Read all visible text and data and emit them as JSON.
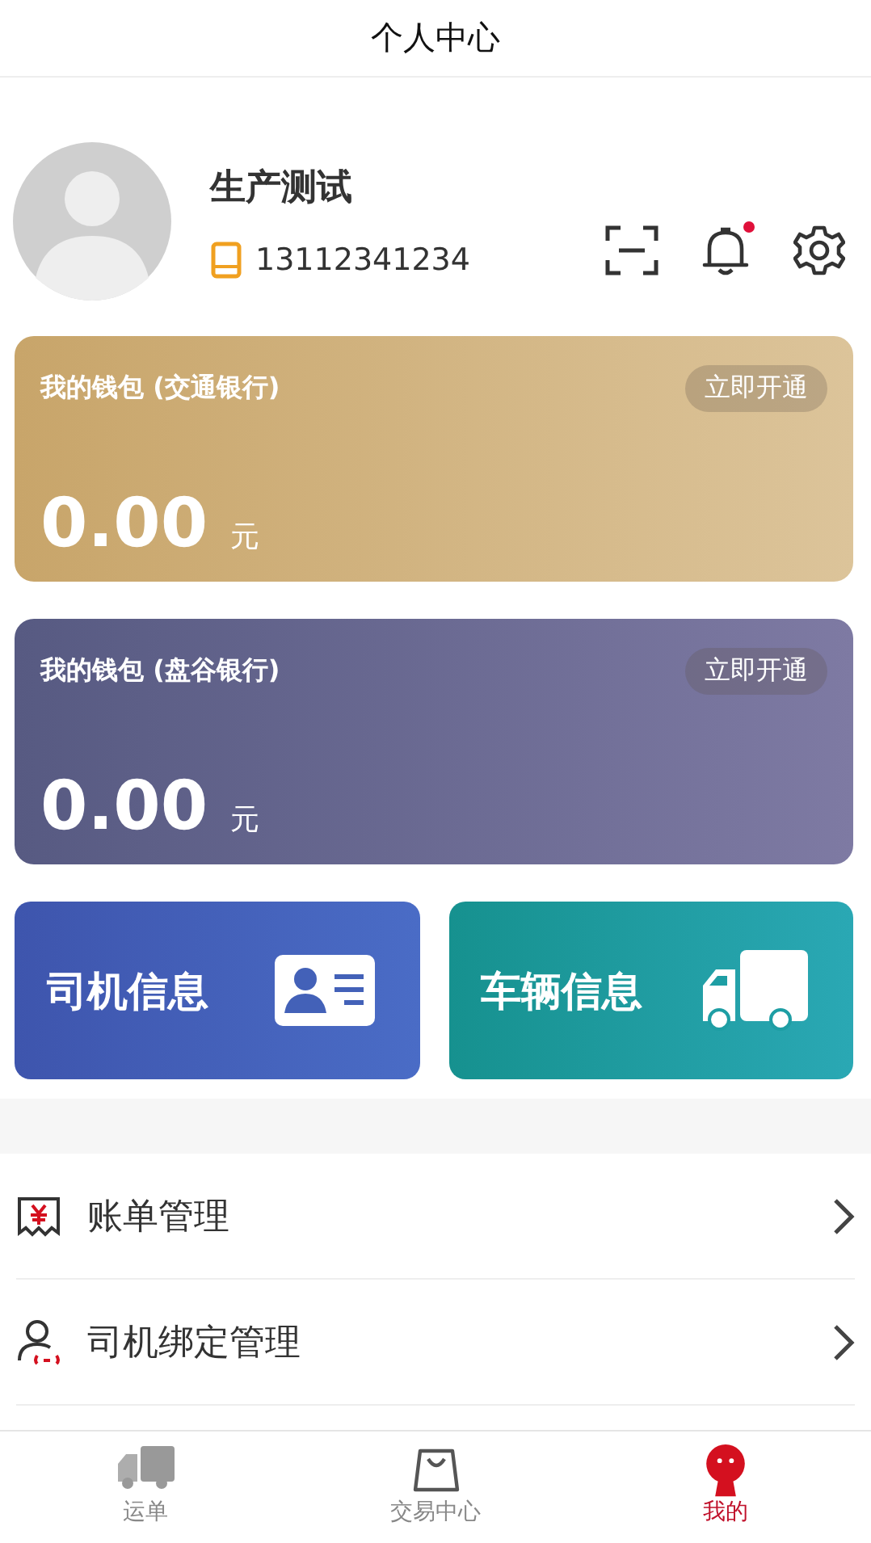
{
  "header": {
    "title": "个人中心"
  },
  "profile": {
    "name": "生产测试",
    "phone": "13112341234",
    "unread": true
  },
  "wallets": [
    {
      "kind": "gold",
      "title": "我的钱包 (交通银行)",
      "button": "立即开通",
      "amount": "0.00",
      "unit": "元"
    },
    {
      "kind": "slate",
      "title": "我的钱包 (盘谷银行)",
      "button": "立即开通",
      "amount": "0.00",
      "unit": "元"
    }
  ],
  "tiles": [
    {
      "kind": "driver",
      "label": "司机信息"
    },
    {
      "kind": "vehicle",
      "label": "车辆信息"
    }
  ],
  "menu": [
    {
      "kind": "bill",
      "label": "账单管理"
    },
    {
      "kind": "binding",
      "label": "司机绑定管理"
    }
  ],
  "tabs": [
    {
      "kind": "waybill",
      "label": "运单",
      "selected": false
    },
    {
      "kind": "trade",
      "label": "交易中心",
      "selected": false
    },
    {
      "kind": "mine",
      "label": "我的",
      "selected": true
    }
  ]
}
